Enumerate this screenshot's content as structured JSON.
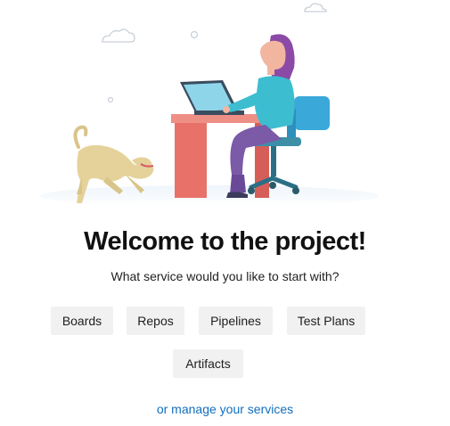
{
  "welcome": {
    "title": "Welcome to the project!",
    "subtitle": "What service would you like to start with?"
  },
  "services": [
    {
      "label": "Boards"
    },
    {
      "label": "Repos"
    },
    {
      "label": "Pipelines"
    },
    {
      "label": "Test Plans"
    },
    {
      "label": "Artifacts"
    }
  ],
  "manage_link": {
    "label": "or manage your services"
  },
  "icons": [
    "cloud-icon",
    "person-at-desk-illustration",
    "dog-illustration"
  ],
  "colors": {
    "link": "#106ebe",
    "button_bg": "#f1f1f1",
    "desk": "#e8726a",
    "chair": "#3aa8d8",
    "shirt": "#3dbdd0",
    "hair": "#8b4aa6"
  }
}
